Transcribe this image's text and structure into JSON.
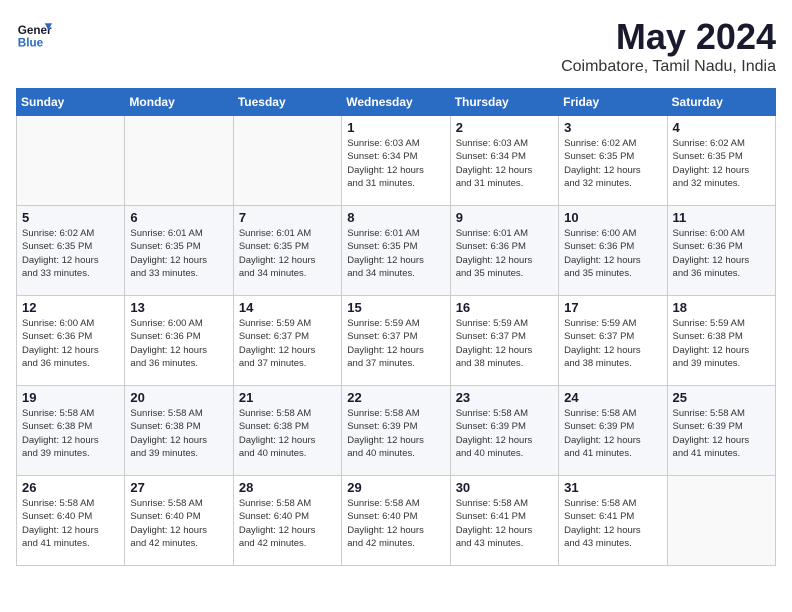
{
  "header": {
    "logo_line1": "General",
    "logo_line2": "Blue",
    "month_year": "May 2024",
    "location": "Coimbatore, Tamil Nadu, India"
  },
  "weekdays": [
    "Sunday",
    "Monday",
    "Tuesday",
    "Wednesday",
    "Thursday",
    "Friday",
    "Saturday"
  ],
  "weeks": [
    [
      {
        "day": "",
        "info": ""
      },
      {
        "day": "",
        "info": ""
      },
      {
        "day": "",
        "info": ""
      },
      {
        "day": "1",
        "info": "Sunrise: 6:03 AM\nSunset: 6:34 PM\nDaylight: 12 hours\nand 31 minutes."
      },
      {
        "day": "2",
        "info": "Sunrise: 6:03 AM\nSunset: 6:34 PM\nDaylight: 12 hours\nand 31 minutes."
      },
      {
        "day": "3",
        "info": "Sunrise: 6:02 AM\nSunset: 6:35 PM\nDaylight: 12 hours\nand 32 minutes."
      },
      {
        "day": "4",
        "info": "Sunrise: 6:02 AM\nSunset: 6:35 PM\nDaylight: 12 hours\nand 32 minutes."
      }
    ],
    [
      {
        "day": "5",
        "info": "Sunrise: 6:02 AM\nSunset: 6:35 PM\nDaylight: 12 hours\nand 33 minutes."
      },
      {
        "day": "6",
        "info": "Sunrise: 6:01 AM\nSunset: 6:35 PM\nDaylight: 12 hours\nand 33 minutes."
      },
      {
        "day": "7",
        "info": "Sunrise: 6:01 AM\nSunset: 6:35 PM\nDaylight: 12 hours\nand 34 minutes."
      },
      {
        "day": "8",
        "info": "Sunrise: 6:01 AM\nSunset: 6:35 PM\nDaylight: 12 hours\nand 34 minutes."
      },
      {
        "day": "9",
        "info": "Sunrise: 6:01 AM\nSunset: 6:36 PM\nDaylight: 12 hours\nand 35 minutes."
      },
      {
        "day": "10",
        "info": "Sunrise: 6:00 AM\nSunset: 6:36 PM\nDaylight: 12 hours\nand 35 minutes."
      },
      {
        "day": "11",
        "info": "Sunrise: 6:00 AM\nSunset: 6:36 PM\nDaylight: 12 hours\nand 36 minutes."
      }
    ],
    [
      {
        "day": "12",
        "info": "Sunrise: 6:00 AM\nSunset: 6:36 PM\nDaylight: 12 hours\nand 36 minutes."
      },
      {
        "day": "13",
        "info": "Sunrise: 6:00 AM\nSunset: 6:36 PM\nDaylight: 12 hours\nand 36 minutes."
      },
      {
        "day": "14",
        "info": "Sunrise: 5:59 AM\nSunset: 6:37 PM\nDaylight: 12 hours\nand 37 minutes."
      },
      {
        "day": "15",
        "info": "Sunrise: 5:59 AM\nSunset: 6:37 PM\nDaylight: 12 hours\nand 37 minutes."
      },
      {
        "day": "16",
        "info": "Sunrise: 5:59 AM\nSunset: 6:37 PM\nDaylight: 12 hours\nand 38 minutes."
      },
      {
        "day": "17",
        "info": "Sunrise: 5:59 AM\nSunset: 6:37 PM\nDaylight: 12 hours\nand 38 minutes."
      },
      {
        "day": "18",
        "info": "Sunrise: 5:59 AM\nSunset: 6:38 PM\nDaylight: 12 hours\nand 39 minutes."
      }
    ],
    [
      {
        "day": "19",
        "info": "Sunrise: 5:58 AM\nSunset: 6:38 PM\nDaylight: 12 hours\nand 39 minutes."
      },
      {
        "day": "20",
        "info": "Sunrise: 5:58 AM\nSunset: 6:38 PM\nDaylight: 12 hours\nand 39 minutes."
      },
      {
        "day": "21",
        "info": "Sunrise: 5:58 AM\nSunset: 6:38 PM\nDaylight: 12 hours\nand 40 minutes."
      },
      {
        "day": "22",
        "info": "Sunrise: 5:58 AM\nSunset: 6:39 PM\nDaylight: 12 hours\nand 40 minutes."
      },
      {
        "day": "23",
        "info": "Sunrise: 5:58 AM\nSunset: 6:39 PM\nDaylight: 12 hours\nand 40 minutes."
      },
      {
        "day": "24",
        "info": "Sunrise: 5:58 AM\nSunset: 6:39 PM\nDaylight: 12 hours\nand 41 minutes."
      },
      {
        "day": "25",
        "info": "Sunrise: 5:58 AM\nSunset: 6:39 PM\nDaylight: 12 hours\nand 41 minutes."
      }
    ],
    [
      {
        "day": "26",
        "info": "Sunrise: 5:58 AM\nSunset: 6:40 PM\nDaylight: 12 hours\nand 41 minutes."
      },
      {
        "day": "27",
        "info": "Sunrise: 5:58 AM\nSunset: 6:40 PM\nDaylight: 12 hours\nand 42 minutes."
      },
      {
        "day": "28",
        "info": "Sunrise: 5:58 AM\nSunset: 6:40 PM\nDaylight: 12 hours\nand 42 minutes."
      },
      {
        "day": "29",
        "info": "Sunrise: 5:58 AM\nSunset: 6:40 PM\nDaylight: 12 hours\nand 42 minutes."
      },
      {
        "day": "30",
        "info": "Sunrise: 5:58 AM\nSunset: 6:41 PM\nDaylight: 12 hours\nand 43 minutes."
      },
      {
        "day": "31",
        "info": "Sunrise: 5:58 AM\nSunset: 6:41 PM\nDaylight: 12 hours\nand 43 minutes."
      },
      {
        "day": "",
        "info": ""
      }
    ]
  ]
}
